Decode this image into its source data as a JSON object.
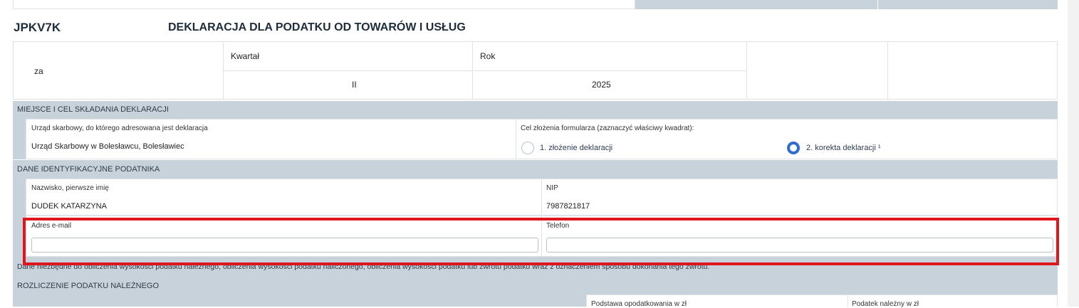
{
  "header": {
    "code": "JPKV7K",
    "title": "DEKLARACJA DLA PODATKU OD TOWARÓW I USŁUG"
  },
  "period": {
    "za_label": "za",
    "quarter_label": "Kwartał",
    "quarter_value": "II",
    "year_label": "Rok",
    "year_value": "2025"
  },
  "section_place": {
    "title": "MIEJSCE I CEL SKŁADANIA DEKLARACJI",
    "office_label": "Urząd skarbowy, do którego adresowana jest deklaracja",
    "office_value": "Urząd Skarbowy w Bolesławcu, Bolesławiec",
    "purpose_label": "Cel złożenia formularza (zaznaczyć właściwy kwadrat):",
    "option1_label": "1. złożenie deklaracji",
    "option2_label": "2. korekta deklaracji ¹",
    "selected_option": 2
  },
  "section_identity": {
    "title": "DANE IDENTYFIKACYJNE PODATNIKA",
    "name_label": "Nazwisko, pierwsze imię",
    "name_value": "DUDEK KATARZYNA",
    "nip_label": "NIP",
    "nip_value": "7987821817",
    "email_label": "Adres e-mail",
    "email_value": "",
    "phone_label": "Telefon",
    "phone_value": ""
  },
  "note_text": "Dane niezbędne do obliczenia wysokości podatku należnego, obliczenia wysokości podatku naliczonego, obliczenia wysokości podatku lub zwrotu podatku wraz z oznaczeniem sposobu dokonania tego zwrotu.",
  "section_output_tax": {
    "title": "ROZLICZENIE PODATKU NALEŻNEGO",
    "col_base": "Podstawa opodatkowania w zł",
    "col_tax": "Podatek należny w zł"
  },
  "colors": {
    "section_bg": "#c7d2db",
    "highlight_border": "#e0161e",
    "radio_selected": "#2f6bd0"
  }
}
